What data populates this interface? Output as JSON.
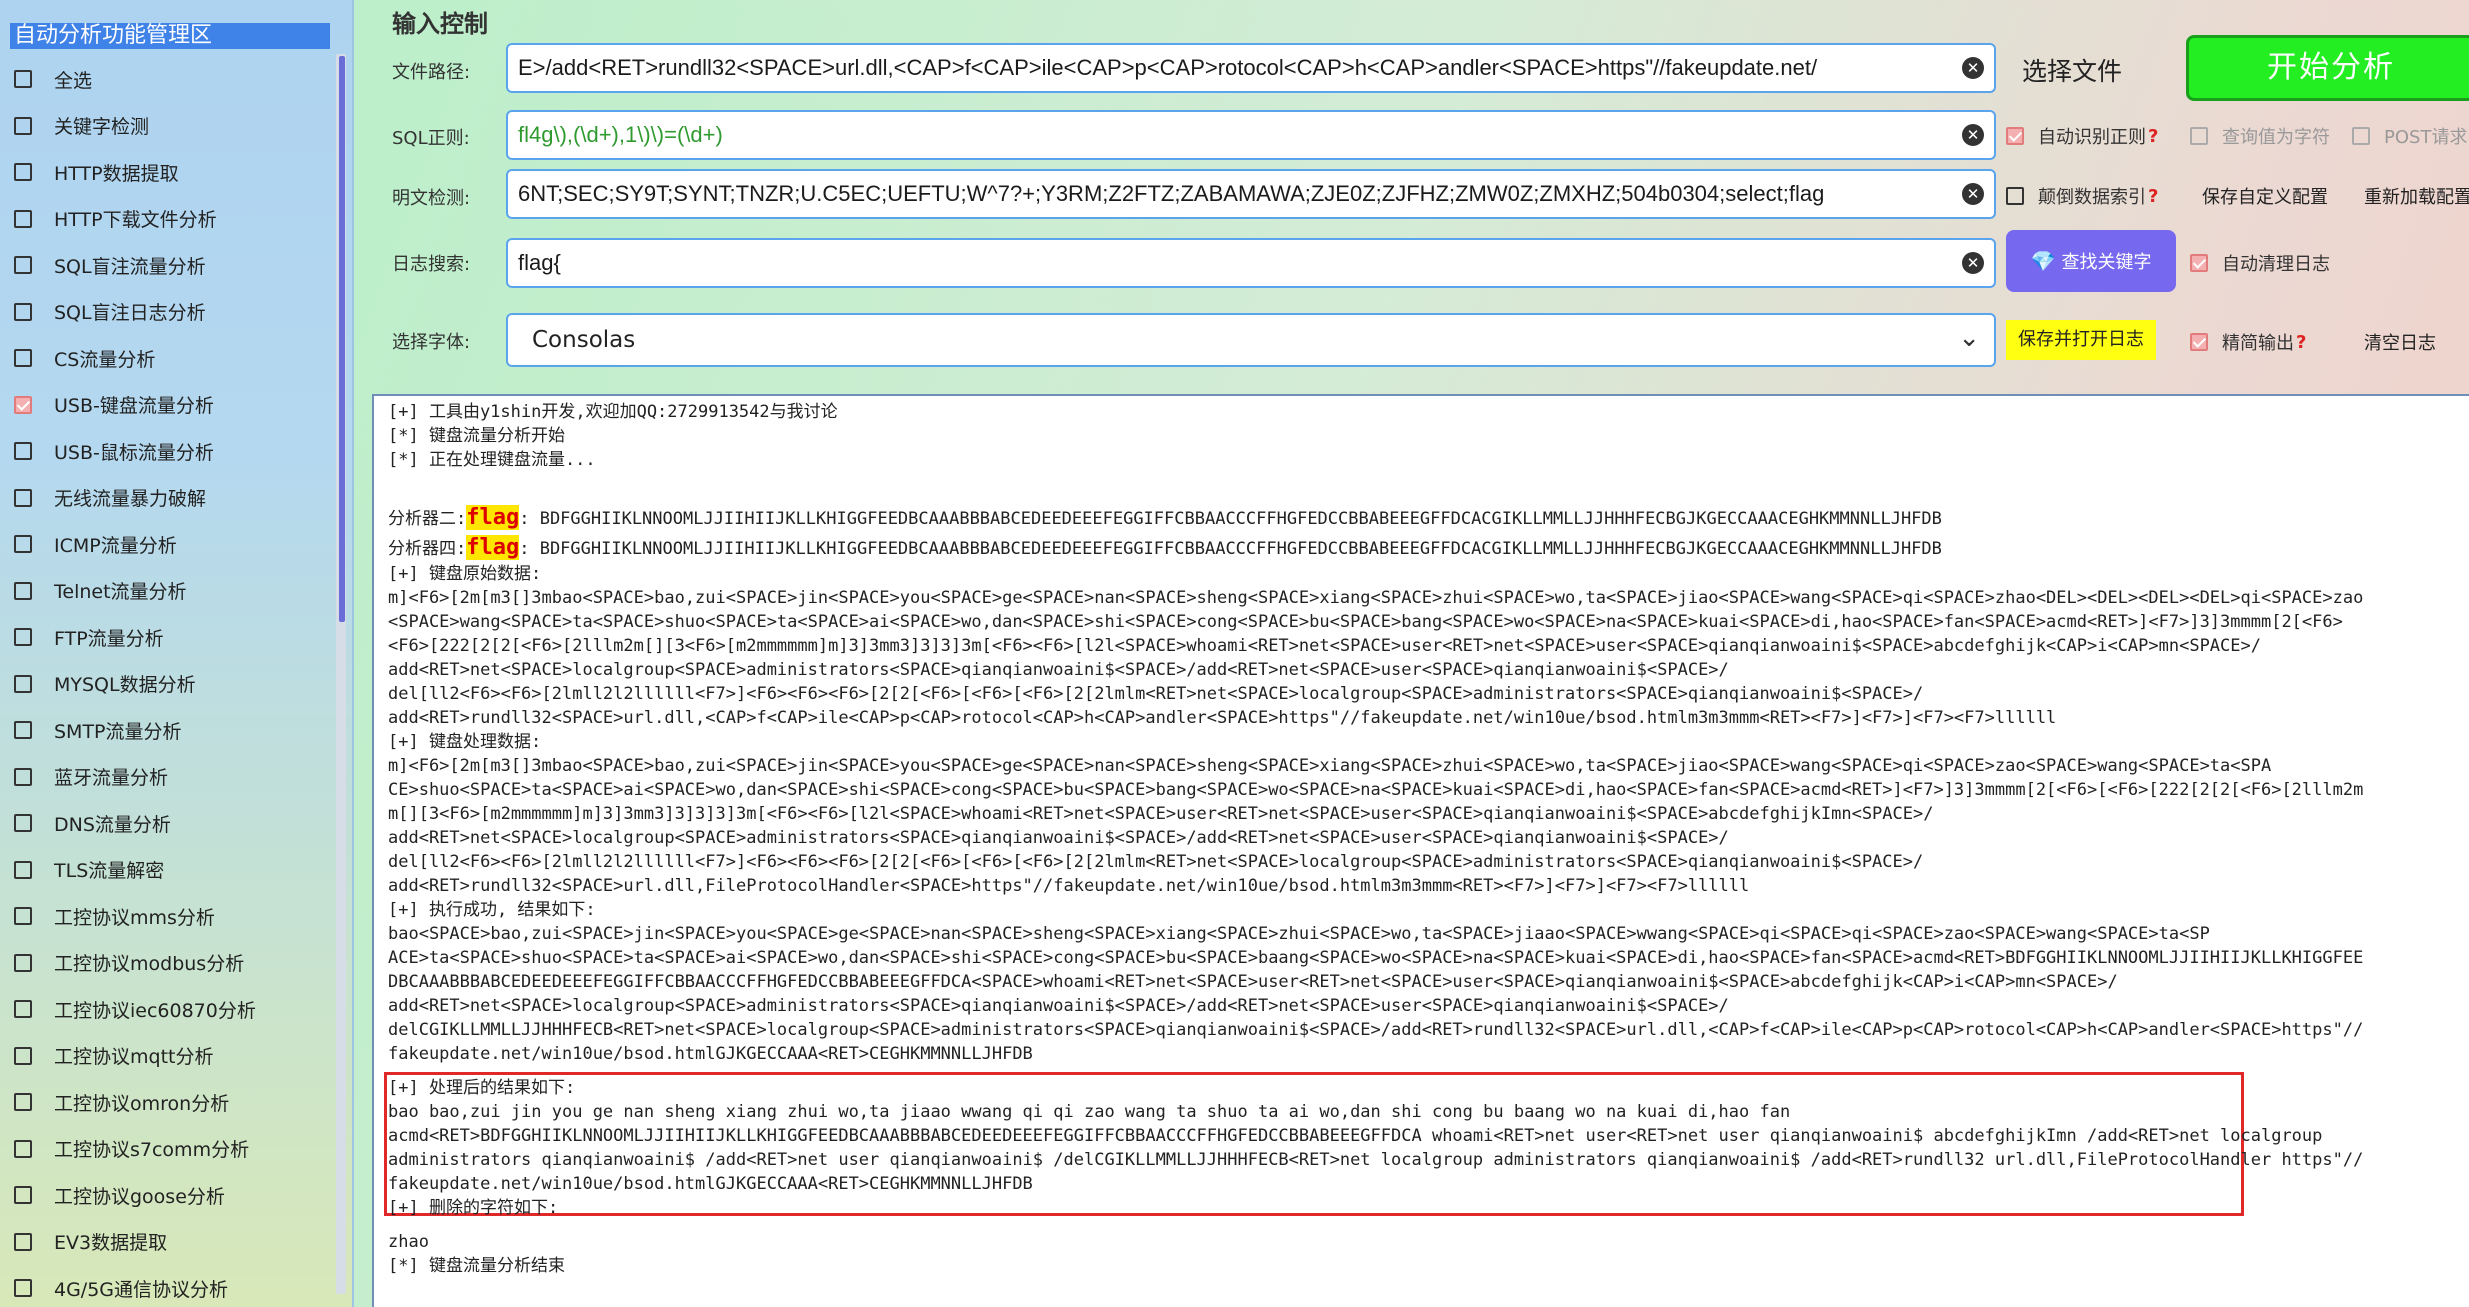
{
  "sidebar": {
    "title": "自动分析功能管理区",
    "items": [
      {
        "label": "全选",
        "checked": false
      },
      {
        "label": "关键字检测",
        "checked": false
      },
      {
        "label": "HTTP数据提取",
        "checked": false
      },
      {
        "label": "HTTP下载文件分析",
        "checked": false
      },
      {
        "label": "SQL盲注流量分析",
        "checked": false
      },
      {
        "label": "SQL盲注日志分析",
        "checked": false
      },
      {
        "label": "CS流量分析",
        "checked": false
      },
      {
        "label": "USB-键盘流量分析",
        "checked": true
      },
      {
        "label": "USB-鼠标流量分析",
        "checked": false
      },
      {
        "label": "无线流量暴力破解",
        "checked": false
      },
      {
        "label": "ICMP流量分析",
        "checked": false
      },
      {
        "label": "Telnet流量分析",
        "checked": false
      },
      {
        "label": "FTP流量分析",
        "checked": false
      },
      {
        "label": "MYSQL数据分析",
        "checked": false
      },
      {
        "label": "SMTP流量分析",
        "checked": false
      },
      {
        "label": "蓝牙流量分析",
        "checked": false
      },
      {
        "label": "DNS流量分析",
        "checked": false
      },
      {
        "label": "TLS流量解密",
        "checked": false
      },
      {
        "label": "工控协议mms分析",
        "checked": false
      },
      {
        "label": "工控协议modbus分析",
        "checked": false
      },
      {
        "label": "工控协议iec60870分析",
        "checked": false
      },
      {
        "label": "工控协议mqtt分析",
        "checked": false
      },
      {
        "label": "工控协议omron分析",
        "checked": false
      },
      {
        "label": "工控协议s7comm分析",
        "checked": false
      },
      {
        "label": "工控协议goose分析",
        "checked": false
      },
      {
        "label": "EV3数据提取",
        "checked": false
      },
      {
        "label": "4G/5G通信协议分析",
        "checked": false
      }
    ]
  },
  "input": {
    "section_title": "输入控制",
    "file_path_label": "文件路径:",
    "file_path_value": "E>/add<RET>rundll32<SPACE>url.dll,<CAP>f<CAP>ile<CAP>p<CAP>rotocol<CAP>h<CAP>andler<SPACE>https\"//fakeupdate.net/",
    "sql_label": "SQL正则:",
    "sql_value": "fl4g\\),(\\d+),1\\)\\)=(\\d+)",
    "plaintext_label": "明文检测:",
    "plaintext_value": "6NT;SEC;SY9T;SYNT;TNZR;U.C5EC;UEFTU;W^7?+;Y3RM;Z2FTZ;ZABAMAWA;ZJE0Z;ZJFHZ;ZMW0Z;ZMXHZ;504b0304;select;flag",
    "log_search_label": "日志搜索:",
    "log_search_value": "flag{",
    "font_label": "选择字体:",
    "font_value": "Consolas",
    "clear_glyph": "✕"
  },
  "buttons": {
    "select_file": "选择文件",
    "start_analysis": "开始分析",
    "find_keyword": "查找关键字",
    "save_open_log": "保存并打开日志",
    "save_custom_config": "保存自定义配置",
    "reload_config": "重新加载配置",
    "clear_log": "清空日志"
  },
  "options": {
    "auto_regex": {
      "label": "自动识别正则",
      "checked": true,
      "help": "?"
    },
    "query_as_char": {
      "label": "查询值为字符",
      "checked": false
    },
    "post_request": {
      "label": "POST请求",
      "checked": false
    },
    "reverse_index": {
      "label": "颠倒数据索引",
      "checked": false,
      "help": "?"
    },
    "auto_clean_log": {
      "label": "自动清理日志",
      "checked": true
    },
    "concise_output": {
      "label": "精简输出",
      "checked": true,
      "help": "?"
    }
  },
  "output": {
    "line01": "[+] 工具由y1shin开发,欢迎加QQ:2729913542与我讨论",
    "line02": "[*] 键盘流量分析开始",
    "line03": "[*] 正在处理键盘流量...",
    "analyzer2_label": "分析器二:",
    "analyzer4_label": "分析器四:",
    "flag_word": "flag",
    "analyzer_value": ": BDFGGHIIKLNNOOMLJJIIHIIJKLLKHIGGFEEDBCAAABBBABCEDEEDEEEFEGGIFFCBBAACCCFFHGFEDCCBBABEEEGFFDCACGIKLLMMLLJJHHHFECBGJKGECCAAACEGHKMMNNLLJHFDB",
    "raw_header": "[+] 键盘原始数据:",
    "raw1": "m]<F6>[2m[m3[]3mbao<SPACE>bao,zui<SPACE>jin<SPACE>you<SPACE>ge<SPACE>nan<SPACE>sheng<SPACE>xiang<SPACE>zhui<SPACE>wo,ta<SPACE>jiao<SPACE>wang<SPACE>qi<SPACE>zhao<DEL><DEL><DEL><DEL>qi<SPACE>zao",
    "raw2": "<SPACE>wang<SPACE>ta<SPACE>shuo<SPACE>ta<SPACE>ai<SPACE>wo,dan<SPACE>shi<SPACE>cong<SPACE>bu<SPACE>bang<SPACE>wo<SPACE>na<SPACE>kuai<SPACE>di,hao<SPACE>fan<SPACE>acmd<RET>]<F7>]3]3mmmm[2[<F6>",
    "raw3": "<F6>[222[2[2[<F6>[2lllm2m[][3<F6>[m2mmmmmm]m]3]3mm3]3]3]3m[<F6><F6>[l2l<SPACE>whoami<RET>net<SPACE>user<RET>net<SPACE>user<SPACE>qianqianwoaini$<SPACE>abcdefghijk<CAP>i<CAP>mn<SPACE>/",
    "raw4": "add<RET>net<SPACE>localgroup<SPACE>administrators<SPACE>qianqianwoaini$<SPACE>/add<RET>net<SPACE>user<SPACE>qianqianwoaini$<SPACE>/",
    "raw5": "del[ll2<F6><F6>[2lmll2l2llllll<F7>]<F6><F6><F6>[2[2[<F6>[<F6>[<F6>[2[2lmlm<RET>net<SPACE>localgroup<SPACE>administrators<SPACE>qianqianwoaini$<SPACE>/",
    "raw6": "add<RET>rundll32<SPACE>url.dll,<CAP>f<CAP>ile<CAP>p<CAP>rotocol<CAP>h<CAP>andler<SPACE>https\"//fakeupdate.net/win10ue/bsod.htmlm3m3mmm<RET><F7>]<F7>]<F7><F7>llllll",
    "proc_header": "[+] 键盘处理数据:",
    "proc1": "m]<F6>[2m[m3[]3mbao<SPACE>bao,zui<SPACE>jin<SPACE>you<SPACE>ge<SPACE>nan<SPACE>sheng<SPACE>xiang<SPACE>zhui<SPACE>wo,ta<SPACE>jiao<SPACE>wang<SPACE>qi<SPACE>zao<SPACE>wang<SPACE>ta<SPA",
    "proc2": "CE>shuo<SPACE>ta<SPACE>ai<SPACE>wo,dan<SPACE>shi<SPACE>cong<SPACE>bu<SPACE>bang<SPACE>wo<SPACE>na<SPACE>kuai<SPACE>di,hao<SPACE>fan<SPACE>acmd<RET>]<F7>]3]3mmmm[2[<F6>[<F6>[222[2[2[<F6>[2lllm2m",
    "proc3": "m[][3<F6>[m2mmmmmm]m]3]3mm3]3]3]3]3m[<F6><F6>[l2l<SPACE>whoami<RET>net<SPACE>user<RET>net<SPACE>user<SPACE>qianqianwoaini$<SPACE>abcdefghijkImn<SPACE>/",
    "proc4": "add<RET>net<SPACE>localgroup<SPACE>administrators<SPACE>qianqianwoaini$<SPACE>/add<RET>net<SPACE>user<SPACE>qianqianwoaini$<SPACE>/",
    "proc5": "del[ll2<F6><F6>[2lmll2l2llllll<F7>]<F6><F6><F6>[2[2[<F6>[<F6>[<F6>[2[2lmlm<RET>net<SPACE>localgroup<SPACE>administrators<SPACE>qianqianwoaini$<SPACE>/",
    "proc6": "add<RET>rundll32<SPACE>url.dll,FileProtocolHandler<SPACE>https\"//fakeupdate.net/win10ue/bsod.htmlm3m3mmm<RET><F7>]<F7>]<F7><F7>llllll",
    "exec_header": "[+] 执行成功, 结果如下:",
    "exec1": "bao<SPACE>bao,zui<SPACE>jin<SPACE>you<SPACE>ge<SPACE>nan<SPACE>sheng<SPACE>xiang<SPACE>zhui<SPACE>wo,ta<SPACE>jiaao<SPACE>wwang<SPACE>qi<SPACE>qi<SPACE>zao<SPACE>wang<SPACE>ta<SP",
    "exec2": "ACE>ta<SPACE>shuo<SPACE>ta<SPACE>ai<SPACE>wo,dan<SPACE>shi<SPACE>cong<SPACE>bu<SPACE>baang<SPACE>wo<SPACE>na<SPACE>kuai<SPACE>di,hao<SPACE>fan<SPACE>acmd<RET>BDFGGHIIKLNNOOMLJJIIHIIJKLLKHIGGFEE",
    "exec3": "DBCAAABBBABCEDEEDEEEFEGGIFFCBBAACCCFFHGFEDCCBBABEEEGFFDCA<SPACE>whoami<RET>net<SPACE>user<RET>net<SPACE>user<SPACE>qianqianwoaini$<SPACE>abcdefghijk<CAP>i<CAP>mn<SPACE>/",
    "exec4": "add<RET>net<SPACE>localgroup<SPACE>administrators<SPACE>qianqianwoaini$<SPACE>/add<RET>net<SPACE>user<SPACE>qianqianwoaini$<SPACE>/",
    "exec5": "delCGIKLLMMLLJJHHHFECB<RET>net<SPACE>localgroup<SPACE>administrators<SPACE>qianqianwoaini$<SPACE>/add<RET>rundll32<SPACE>url.dll,<CAP>f<CAP>ile<CAP>p<CAP>rotocol<CAP>h<CAP>andler<SPACE>https\"//",
    "exec6": "fakeupdate.net/win10ue/bsod.htmlGJKGECCAAA<RET>CEGHKMMNNLLJHFDB",
    "result_header": "[+] 处理后的结果如下:",
    "res1": "bao bao,zui jin you ge nan sheng xiang zhui wo,ta jiaao wwang qi qi zao wang ta shuo ta ai wo,dan shi cong bu baang wo na kuai di,hao fan",
    "res2": "acmd<RET>BDFGGHIIKLNNOOMLJJIIHIIJKLLKHIGGFEEDBCAAABBBABCEDEEDEEEFEGGIFFCBBAACCCFFHGFEDCCBBABEEEGFFDCA whoami<RET>net user<RET>net user qianqianwoaini$ abcdefghijkImn /add<RET>net localgroup",
    "res3": "administrators qianqianwoaini$ /add<RET>net user qianqianwoaini$ /delCGIKLLMMLLJJHHHFECB<RET>net localgroup administrators qianqianwoaini$ /add<RET>rundll32 url.dll,FileProtocolHandler https\"//",
    "res4": "fakeupdate.net/win10ue/bsod.htmlGJKGECCAAA<RET>CEGHKMMNNLLJHFDB",
    "deleted_header": "[+] 删除的字符如下:",
    "deleted_value": "zhao",
    "end_line": "[*] 键盘流量分析结束"
  }
}
